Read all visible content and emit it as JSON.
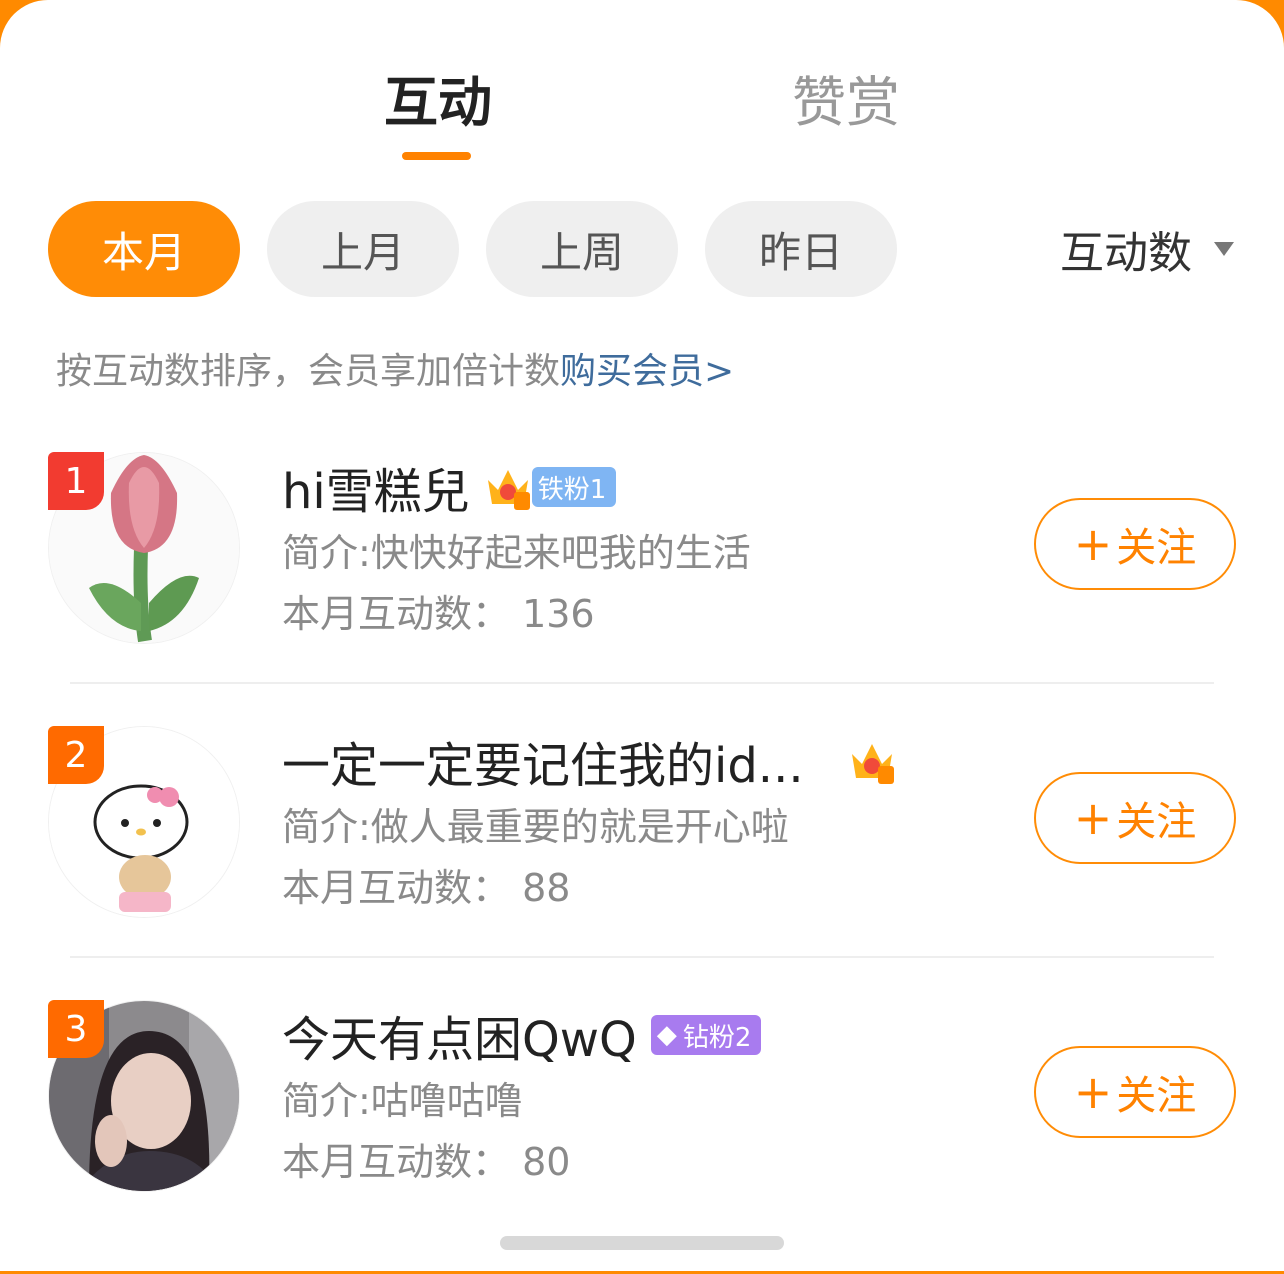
{
  "tabs": {
    "active": "互动",
    "inactive": "赞赏"
  },
  "filters": [
    "本月",
    "上月",
    "上周",
    "昨日"
  ],
  "sort": {
    "label": "互动数"
  },
  "hint": {
    "text": "按互动数排序，会员享加倍计数",
    "link": "购买会员>"
  },
  "follow_label": "关注",
  "users": [
    {
      "rank": "1",
      "name": "hi雪糕兒",
      "crown_level": "5",
      "badge": "铁粉1",
      "intro": "简介:快快好起来吧我的生活",
      "count": "本月互动数：  136"
    },
    {
      "rank": "2",
      "name": "一定一定要记住我的id...",
      "crown_level": "4",
      "badge": "",
      "intro": "简介:做人最重要的就是开心啦",
      "count": "本月互动数：  88"
    },
    {
      "rank": "3",
      "name": "今天有点困QwQ",
      "crown_level": "",
      "badge": "钻粉2",
      "intro": "简介:咕噜咕噜",
      "count": "本月互动数：  80"
    }
  ],
  "colors": {
    "accent": "#ff8200",
    "link": "#3f6c9c"
  }
}
